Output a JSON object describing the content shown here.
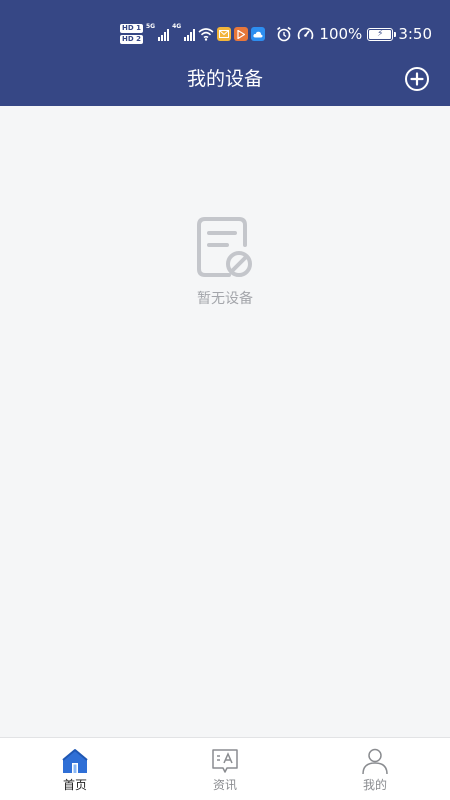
{
  "status_bar": {
    "sim1_label": "HD 1",
    "sim2_label": "HD 2",
    "net1": "5G",
    "net2": "4G",
    "battery": "100%",
    "time": "3:50",
    "icons": [
      "signal-icon",
      "wifi-icon",
      "mail-app-icon",
      "video-app-icon",
      "cloud-app-icon",
      "alarm-icon",
      "speed-icon",
      "battery-icon"
    ]
  },
  "header": {
    "title": "我的设备",
    "add_icon": "plus-circle-icon",
    "background": "#364785"
  },
  "empty_state": {
    "icon": "no-device-icon",
    "text": "暂无设备"
  },
  "tabbar": {
    "active_color": "#2f6fd6",
    "tabs": [
      {
        "label": "首页",
        "icon": "home-icon",
        "active": true
      },
      {
        "label": "资讯",
        "icon": "news-icon",
        "active": false
      },
      {
        "label": "我的",
        "icon": "profile-icon",
        "active": false
      }
    ]
  }
}
